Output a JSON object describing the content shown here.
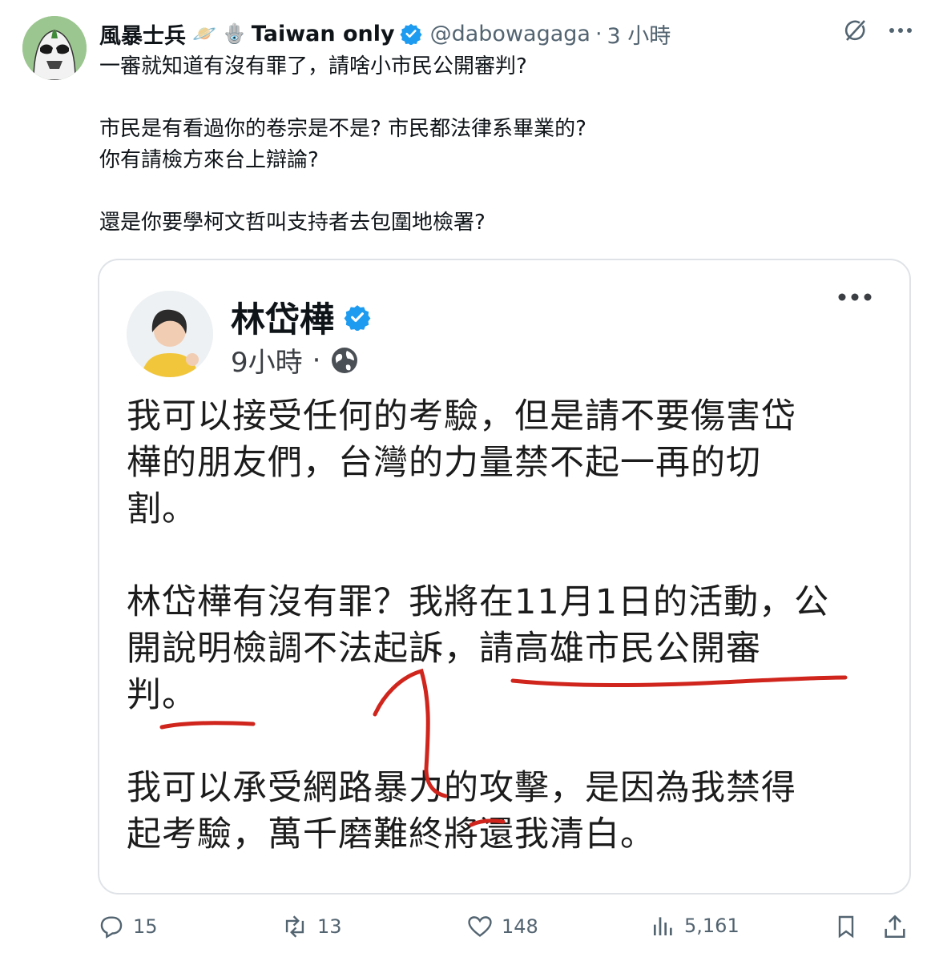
{
  "post": {
    "author_name": "風暴士兵",
    "emoji_ring": "🪐",
    "emoji_hand": "🪬",
    "author_tag": "Taiwan only",
    "handle": "@dabowagaga",
    "separator": "·",
    "time": "3 小時",
    "lines": [
      "一審就知道有沒有罪了，請啥小市民公開審判?",
      "",
      "市民是有看過你的卷宗是不是? 市民都法律系畢業的?",
      "你有請檢方來台上辯論?",
      "",
      "還是你要學柯文哲叫支持者去包圍地檢署?"
    ]
  },
  "quoted": {
    "name": "林岱樺",
    "time": "9小時",
    "separator": "·",
    "paragraphs": [
      [
        "我可以接受任何的考驗，但是請不要傷害岱",
        "樺的朋友們，台灣的力量禁不起一再的切",
        "割。"
      ],
      [
        "林岱樺有沒有罪？我將在11月1日的活動，公",
        "開說明檢調不法起訴，請高雄市民公開審",
        "判。"
      ],
      [
        "我可以承受網路暴力的攻擊，是因為我禁得",
        "起考驗，萬千磨難終將還我清白。"
      ]
    ]
  },
  "actions": {
    "replies": "15",
    "reposts": "13",
    "likes": "148",
    "views": "5,161"
  },
  "colors": {
    "verified": "#1d9bf0",
    "secondary_text": "#536471",
    "annotation": "#d0251c"
  },
  "icons": [
    "grok-icon",
    "more-icon",
    "verified-badge-icon",
    "globe-icon",
    "reply-icon",
    "repost-icon",
    "like-icon",
    "views-icon",
    "bookmark-icon",
    "share-icon"
  ]
}
